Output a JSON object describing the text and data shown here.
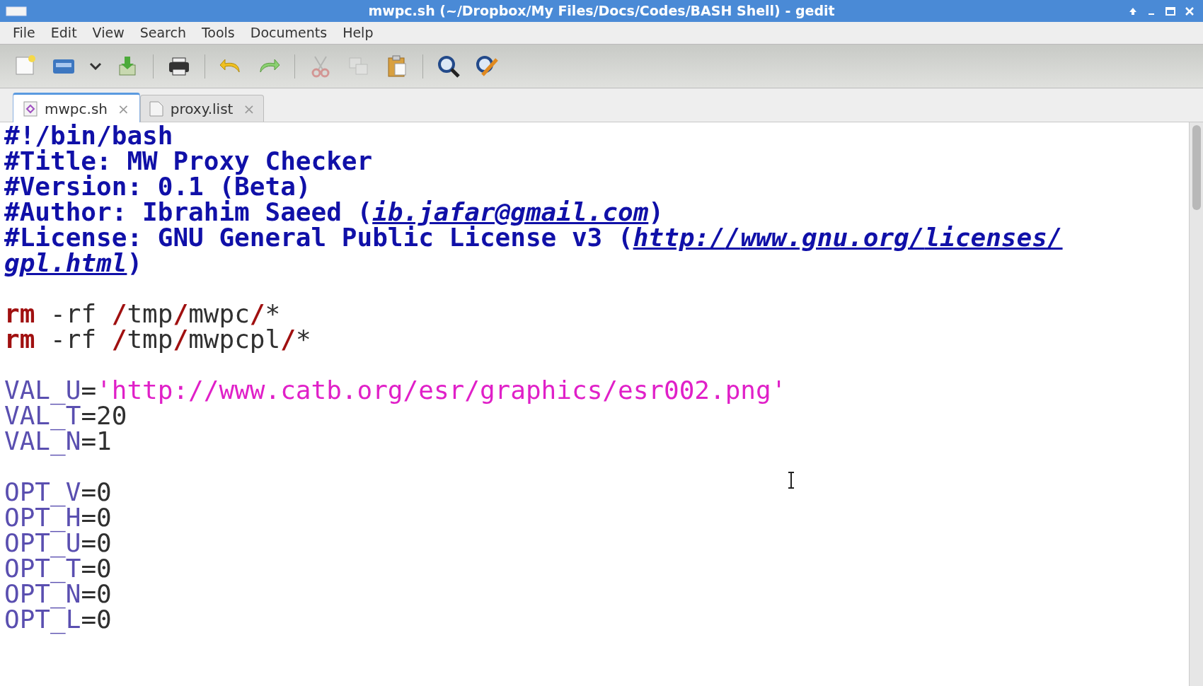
{
  "window": {
    "title": "mwpc.sh (~/Dropbox/My Files/Docs/Codes/BASH Shell) - gedit"
  },
  "menu": [
    "File",
    "Edit",
    "View",
    "Search",
    "Tools",
    "Documents",
    "Help"
  ],
  "toolbar": [
    {
      "kind": "new",
      "disabled": false
    },
    {
      "kind": "open",
      "disabled": false
    },
    {
      "kind": "dropdown",
      "disabled": false
    },
    {
      "kind": "save",
      "disabled": false
    },
    {
      "kind": "sep"
    },
    {
      "kind": "print",
      "disabled": false
    },
    {
      "kind": "sep"
    },
    {
      "kind": "undo",
      "disabled": false
    },
    {
      "kind": "redo",
      "disabled": false
    },
    {
      "kind": "sep"
    },
    {
      "kind": "cut",
      "disabled": true
    },
    {
      "kind": "copy",
      "disabled": true
    },
    {
      "kind": "paste",
      "disabled": false
    },
    {
      "kind": "sep"
    },
    {
      "kind": "find",
      "disabled": false
    },
    {
      "kind": "replace",
      "disabled": false
    }
  ],
  "tabs": [
    {
      "label": "mwpc.sh",
      "close": "×",
      "kind": "script",
      "selected": true
    },
    {
      "label": "proxy.list",
      "close": "×",
      "kind": "text",
      "selected": false
    }
  ],
  "lines": [
    {
      "tokens": [
        {
          "text": "#!/bin/bash",
          "kind": "comment"
        }
      ]
    },
    {
      "tokens": [
        {
          "text": "#Title: MW Proxy Checker",
          "kind": "comment"
        }
      ]
    },
    {
      "tokens": [
        {
          "text": "#Version: 0.1 (Beta)",
          "kind": "comment"
        }
      ]
    },
    {
      "tokens": [
        {
          "text": "#Author: Ibrahim Saeed (",
          "kind": "comment"
        },
        {
          "text": "ib.jafar@gmail.com",
          "kind": "link"
        },
        {
          "text": ")",
          "kind": "comment"
        }
      ]
    },
    {
      "tokens": [
        {
          "text": "#License: GNU General Public License v3 (",
          "kind": "comment"
        },
        {
          "text": "http://www.gnu.org/licenses/gpl.html",
          "kind": "link"
        },
        {
          "text": ")",
          "kind": "comment"
        }
      ]
    },
    {
      "blank": true
    },
    {
      "tokens": [
        {
          "text": "rm",
          "kind": "keyword"
        },
        {
          "text": " -rf ",
          "kind": "plain"
        },
        {
          "text": "/",
          "kind": "keyword"
        },
        {
          "text": "tmp",
          "kind": "plain"
        },
        {
          "text": "/",
          "kind": "keyword"
        },
        {
          "text": "mwpc",
          "kind": "plain"
        },
        {
          "text": "/",
          "kind": "keyword"
        },
        {
          "text": "*",
          "kind": "plain"
        }
      ]
    },
    {
      "tokens": [
        {
          "text": "rm",
          "kind": "keyword"
        },
        {
          "text": " -rf ",
          "kind": "plain"
        },
        {
          "text": "/",
          "kind": "keyword"
        },
        {
          "text": "tmp",
          "kind": "plain"
        },
        {
          "text": "/",
          "kind": "keyword"
        },
        {
          "text": "mwpcpl",
          "kind": "plain"
        },
        {
          "text": "/",
          "kind": "keyword"
        },
        {
          "text": "*",
          "kind": "plain"
        }
      ]
    },
    {
      "blank": true
    },
    {
      "tokens": [
        {
          "text": "VAL_U",
          "kind": "variable"
        },
        {
          "text": "=",
          "kind": "plain"
        },
        {
          "text": "'http://www.catb.org/esr/graphics/esr002.png'",
          "kind": "string"
        }
      ]
    },
    {
      "tokens": [
        {
          "text": "VAL_T",
          "kind": "variable"
        },
        {
          "text": "=20",
          "kind": "plain"
        }
      ]
    },
    {
      "tokens": [
        {
          "text": "VAL_N",
          "kind": "variable"
        },
        {
          "text": "=1",
          "kind": "plain"
        }
      ]
    },
    {
      "blank": true
    },
    {
      "tokens": [
        {
          "text": "OPT_V",
          "kind": "variable"
        },
        {
          "text": "=0",
          "kind": "plain"
        }
      ]
    },
    {
      "tokens": [
        {
          "text": "OPT_H",
          "kind": "variable"
        },
        {
          "text": "=0",
          "kind": "plain"
        }
      ]
    },
    {
      "tokens": [
        {
          "text": "OPT_U",
          "kind": "variable"
        },
        {
          "text": "=0",
          "kind": "plain"
        }
      ]
    },
    {
      "tokens": [
        {
          "text": "OPT_T",
          "kind": "variable"
        },
        {
          "text": "=0",
          "kind": "plain"
        }
      ]
    },
    {
      "tokens": [
        {
          "text": "OPT_N",
          "kind": "variable"
        },
        {
          "text": "=0",
          "kind": "plain"
        }
      ]
    },
    {
      "tokens": [
        {
          "text": "OPT_L",
          "kind": "variable"
        },
        {
          "text": "=0",
          "kind": "plain"
        }
      ]
    }
  ]
}
